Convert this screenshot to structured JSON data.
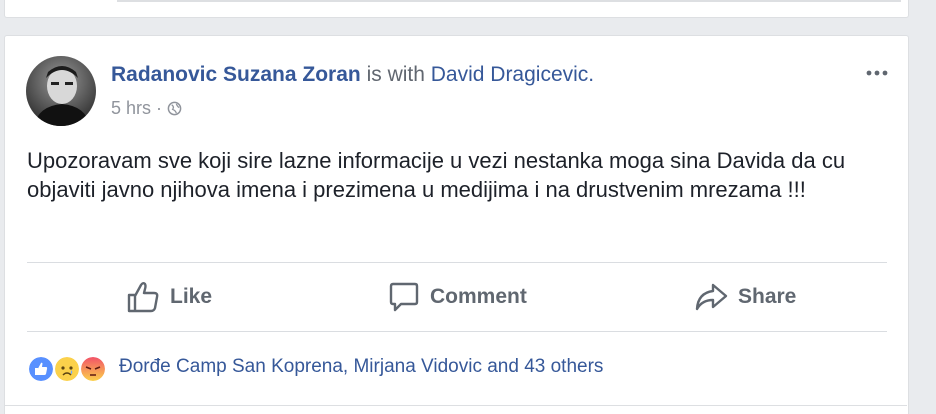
{
  "post": {
    "author": "Radanovic Suzana Zoran",
    "with_text": " is with ",
    "tagged": "David Dragicevic.",
    "time": "5 hrs",
    "separator": "·",
    "privacy_icon": "globe-icon",
    "more_icon": "ellipsis-icon",
    "body": "Upozoravam sve koji sire lazne informacije u vezi nestanka moga sina Davida da cu objaviti javno njihova imena i prezimena u medijima i na drustvenim mrezama !!!"
  },
  "actions": {
    "like": "Like",
    "comment": "Comment",
    "share": "Share"
  },
  "reactions": {
    "icons": [
      "like-icon",
      "sad-icon",
      "angry-icon"
    ],
    "summary": "Đorđe Camp San Koprena, Mirjana Vidovic and 43 others"
  },
  "colors": {
    "link": "#365899",
    "text": "#1d2129",
    "muted": "#90949c",
    "like_blue": "#5890ff",
    "angry": "#f25268",
    "sad": "#fbd14b"
  }
}
